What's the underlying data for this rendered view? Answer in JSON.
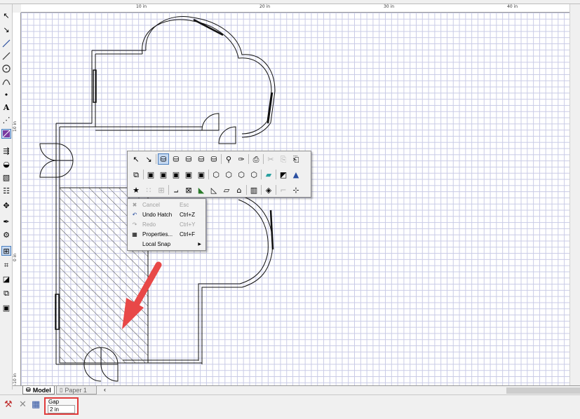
{
  "colors": {
    "accent": "#4a7fc0",
    "highlight_box": "#e03a3a",
    "arrow": "#e84848",
    "grid": "#c9cbe6"
  },
  "ruler": {
    "top_labels": [
      "10 in",
      "20 in",
      "30 in",
      "40 in"
    ],
    "left_labels": [
      "10 in",
      "0 in",
      "-10 in"
    ]
  },
  "tabs": {
    "model": "Model",
    "paper": "Paper 1"
  },
  "context_menu": {
    "items": [
      {
        "icon": "cancel-icon",
        "label": "Cancel",
        "shortcut": "Esc",
        "enabled": false
      },
      {
        "icon": "undo-icon",
        "label": "Undo Hatch",
        "shortcut": "Ctrl+Z",
        "enabled": true
      },
      {
        "icon": "redo-icon",
        "label": "Redo",
        "shortcut": "Ctrl+Y",
        "enabled": false
      },
      {
        "icon": "properties-icon",
        "label": "Properties...",
        "shortcut": "Ctrl+F",
        "enabled": true
      },
      {
        "icon": "",
        "label": "Local Snap",
        "shortcut": "",
        "enabled": true,
        "submenu": true
      }
    ]
  },
  "inspector": {
    "field_label": "Gap",
    "field_value": "2 in"
  }
}
